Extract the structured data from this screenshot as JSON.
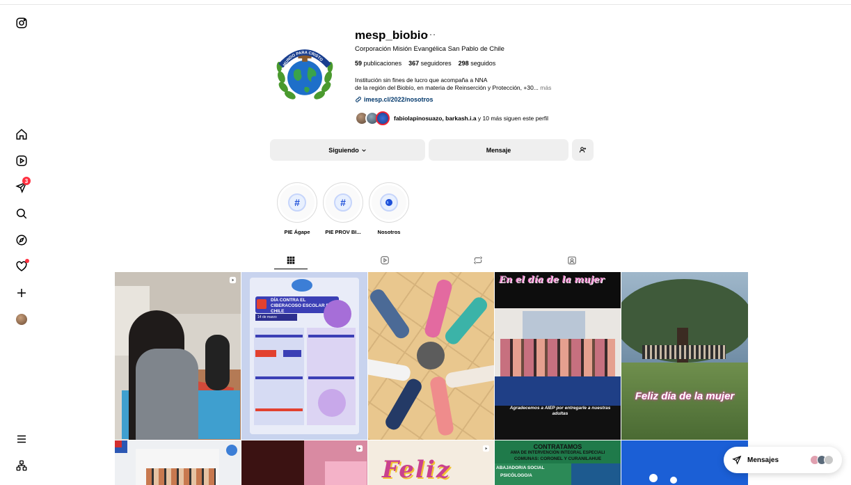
{
  "profile": {
    "username": "mesp_biobio",
    "more_glyph": "···",
    "full_name": "Corporación Misión Evangélica San Pablo de Chile",
    "stats": {
      "posts_count": "59",
      "posts_label": "publicaciones",
      "followers_count": "367",
      "followers_label": "seguidores",
      "following_count": "298",
      "following_label": "seguidos"
    },
    "bio_line1": "Institución sin fines de lucro que acompaña a NNA",
    "bio_line2": "de la región del Biobío, en materia de Reinserción y Protección, +30...",
    "bio_more": "más",
    "link": "imesp.cl/2022/nosotros",
    "followed_by_names": "fabiolapinosuazo, barkash.i.a",
    "followed_by_rest": " y 10 más siguen este perfil",
    "logo_text": "EL MUNDO PARA CRISTO"
  },
  "buttons": {
    "following": "Siguiendo",
    "message": "Mensaje"
  },
  "highlights": [
    {
      "label": "PIE Ágape",
      "icon": "hashtag-icon"
    },
    {
      "label": "PIE PROV BI...",
      "icon": "hashtag-icon"
    },
    {
      "label": "Nosotros",
      "icon": "globe-icon"
    }
  ],
  "tabs": [
    "posts-grid-icon",
    "reels-icon",
    "reposts-icon",
    "tagged-icon"
  ],
  "posts": {
    "p2_title": "DÍA CONTRA EL CIBERACOSO ESCOLAR EN CHILE",
    "p2_date": "14 de marzo",
    "p4_title": "En el día de la mujer",
    "p4_caption": "Agradecemos a AIEP por entregarle a nuestras adultas",
    "p5_text": "Feliz día de la mujer",
    "p8_text": "Feliz",
    "p9_title": "CONTRATAMOS",
    "p9_sub1": "AMA DE INTERVENCIÓN INTEGRAL ESPECIALI",
    "p9_sub2": "COMUNAS: CORONEL Y CURANILAHUE",
    "p9_role1": "ABAJADOR/A SOCIAL",
    "p9_role2": "PSICÓLOGO/A"
  },
  "messages_pill": {
    "label": "Mensajes"
  },
  "colors": {
    "badge_red": "#ff3040",
    "link_blue": "#00376b",
    "button_gray": "#efefef"
  },
  "notifications_count": "3"
}
